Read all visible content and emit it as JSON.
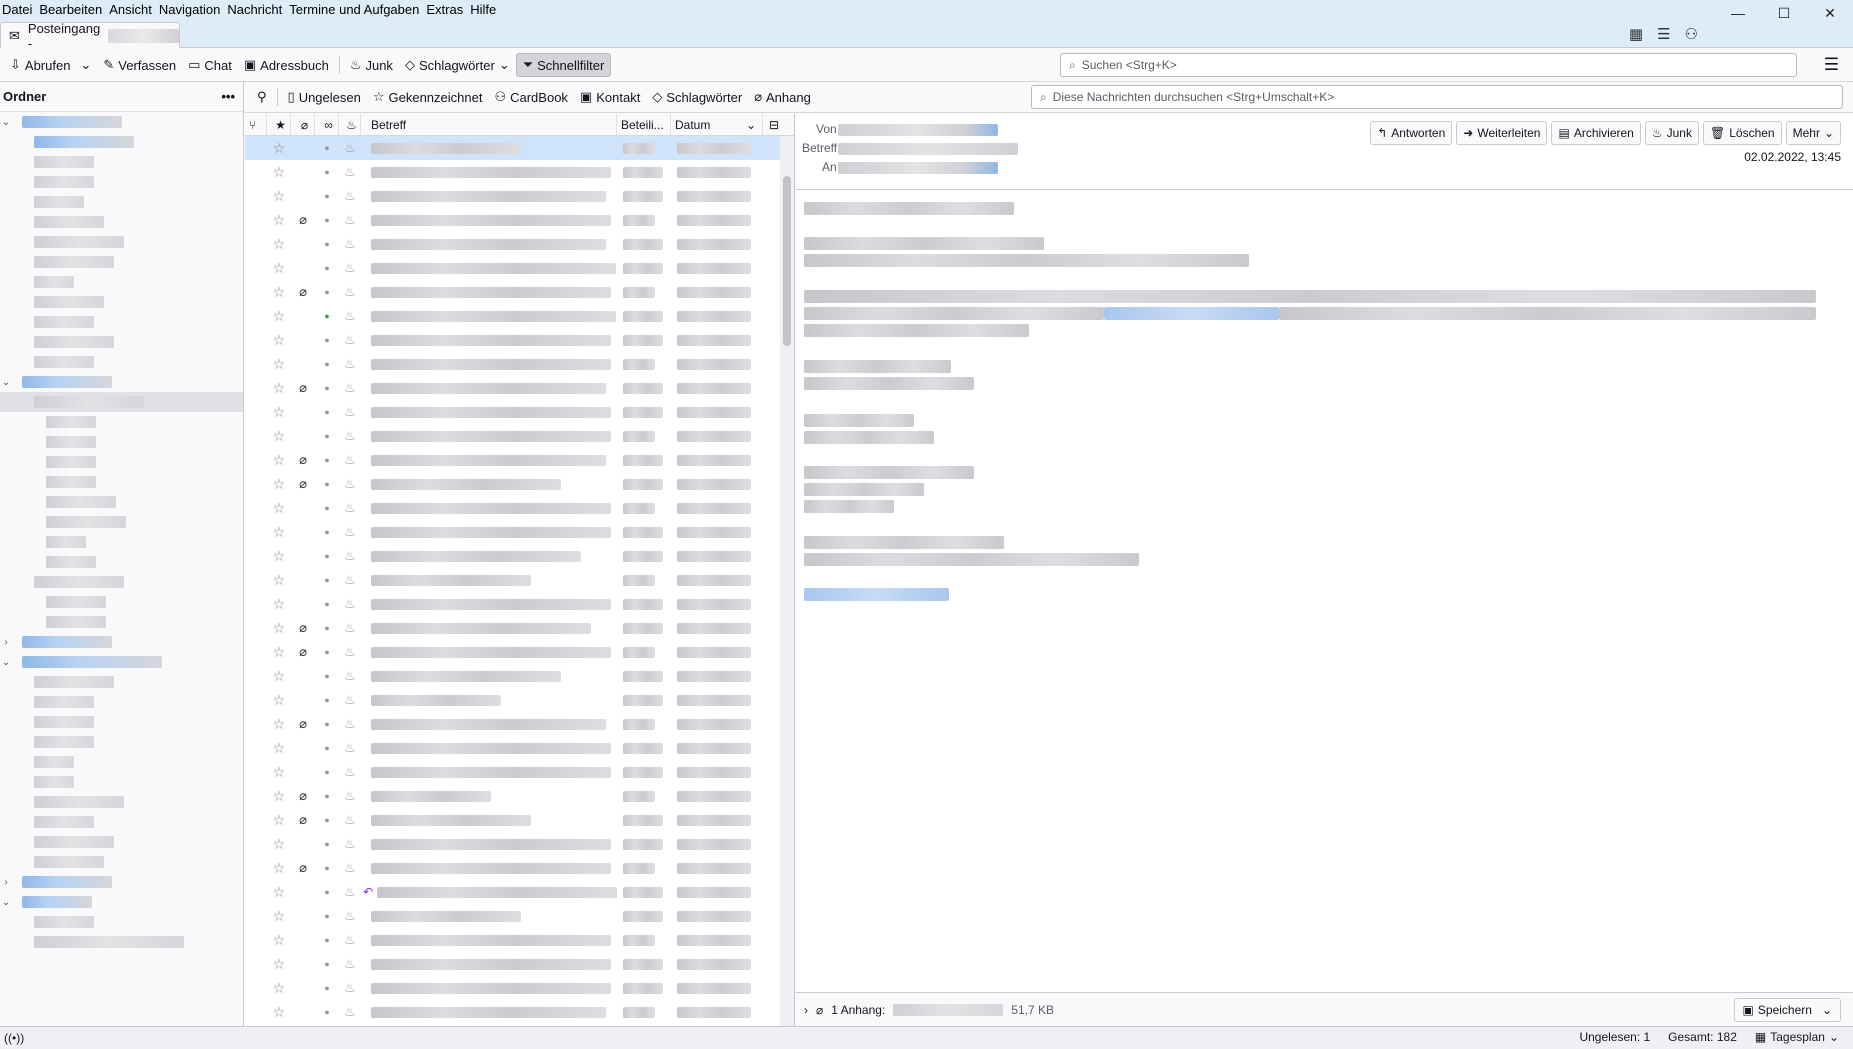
{
  "menu": [
    "Datei",
    "Bearbeiten",
    "Ansicht",
    "Navigation",
    "Nachricht",
    "Termine und Aufgaben",
    "Extras",
    "Hilfe"
  ],
  "tab": {
    "label": "Posteingang -"
  },
  "toolbar": {
    "get_messages": "Abrufen",
    "write": "Verfassen",
    "chat": "Chat",
    "address_book": "Adressbuch",
    "junk": "Junk",
    "tags": "Schlagwörter",
    "quick_filter": "Schnellfilter"
  },
  "global_search": {
    "placeholder": "Suchen <Strg+K>"
  },
  "folder_pane": {
    "header": "Ordner"
  },
  "quick_filter": {
    "unread": "Ungelesen",
    "starred": "Gekennzeichnet",
    "cardbook": "CardBook",
    "contact": "Kontakt",
    "tags": "Schlagwörter",
    "attachment": "Anhang",
    "search_placeholder": "Diese Nachrichten durchsuchen <Strg+Umschalt+K>"
  },
  "thread_columns": {
    "subject": "Betreff",
    "correspondents": "Beteili...",
    "date": "Datum"
  },
  "message_header": {
    "from_label": "Von",
    "subject_label": "Betreff",
    "to_label": "An",
    "date": "02.02.2022, 13:45",
    "buttons": {
      "reply": "Antworten",
      "forward": "Weiterleiten",
      "archive": "Archivieren",
      "junk": "Junk",
      "delete": "Löschen",
      "more": "Mehr"
    }
  },
  "attachment_bar": {
    "label": "1 Anhang:",
    "size": "51,7 KB",
    "save": "Speichern"
  },
  "status_bar": {
    "unread": "Ungelesen: 1",
    "total": "Gesamt: 182",
    "today_pane": "Tagesplan"
  },
  "messages": [
    {
      "att": false,
      "selected": true
    },
    {
      "att": false
    },
    {
      "att": false
    },
    {
      "att": true
    },
    {
      "att": false
    },
    {
      "att": false
    },
    {
      "att": true
    },
    {
      "att": false,
      "green": true
    },
    {
      "att": false
    },
    {
      "att": false
    },
    {
      "att": true
    },
    {
      "att": false
    },
    {
      "att": false
    },
    {
      "att": true
    },
    {
      "att": true
    },
    {
      "att": false
    },
    {
      "att": false
    },
    {
      "att": false
    },
    {
      "att": false
    },
    {
      "att": false
    },
    {
      "att": true
    },
    {
      "att": true
    },
    {
      "att": false
    },
    {
      "att": false
    },
    {
      "att": true
    },
    {
      "att": false
    },
    {
      "att": false
    },
    {
      "att": true
    },
    {
      "att": true
    },
    {
      "att": false
    },
    {
      "att": true
    },
    {
      "att": false,
      "replied": true
    },
    {
      "att": false
    },
    {
      "att": false
    },
    {
      "att": false
    },
    {
      "att": false
    },
    {
      "att": false
    }
  ]
}
